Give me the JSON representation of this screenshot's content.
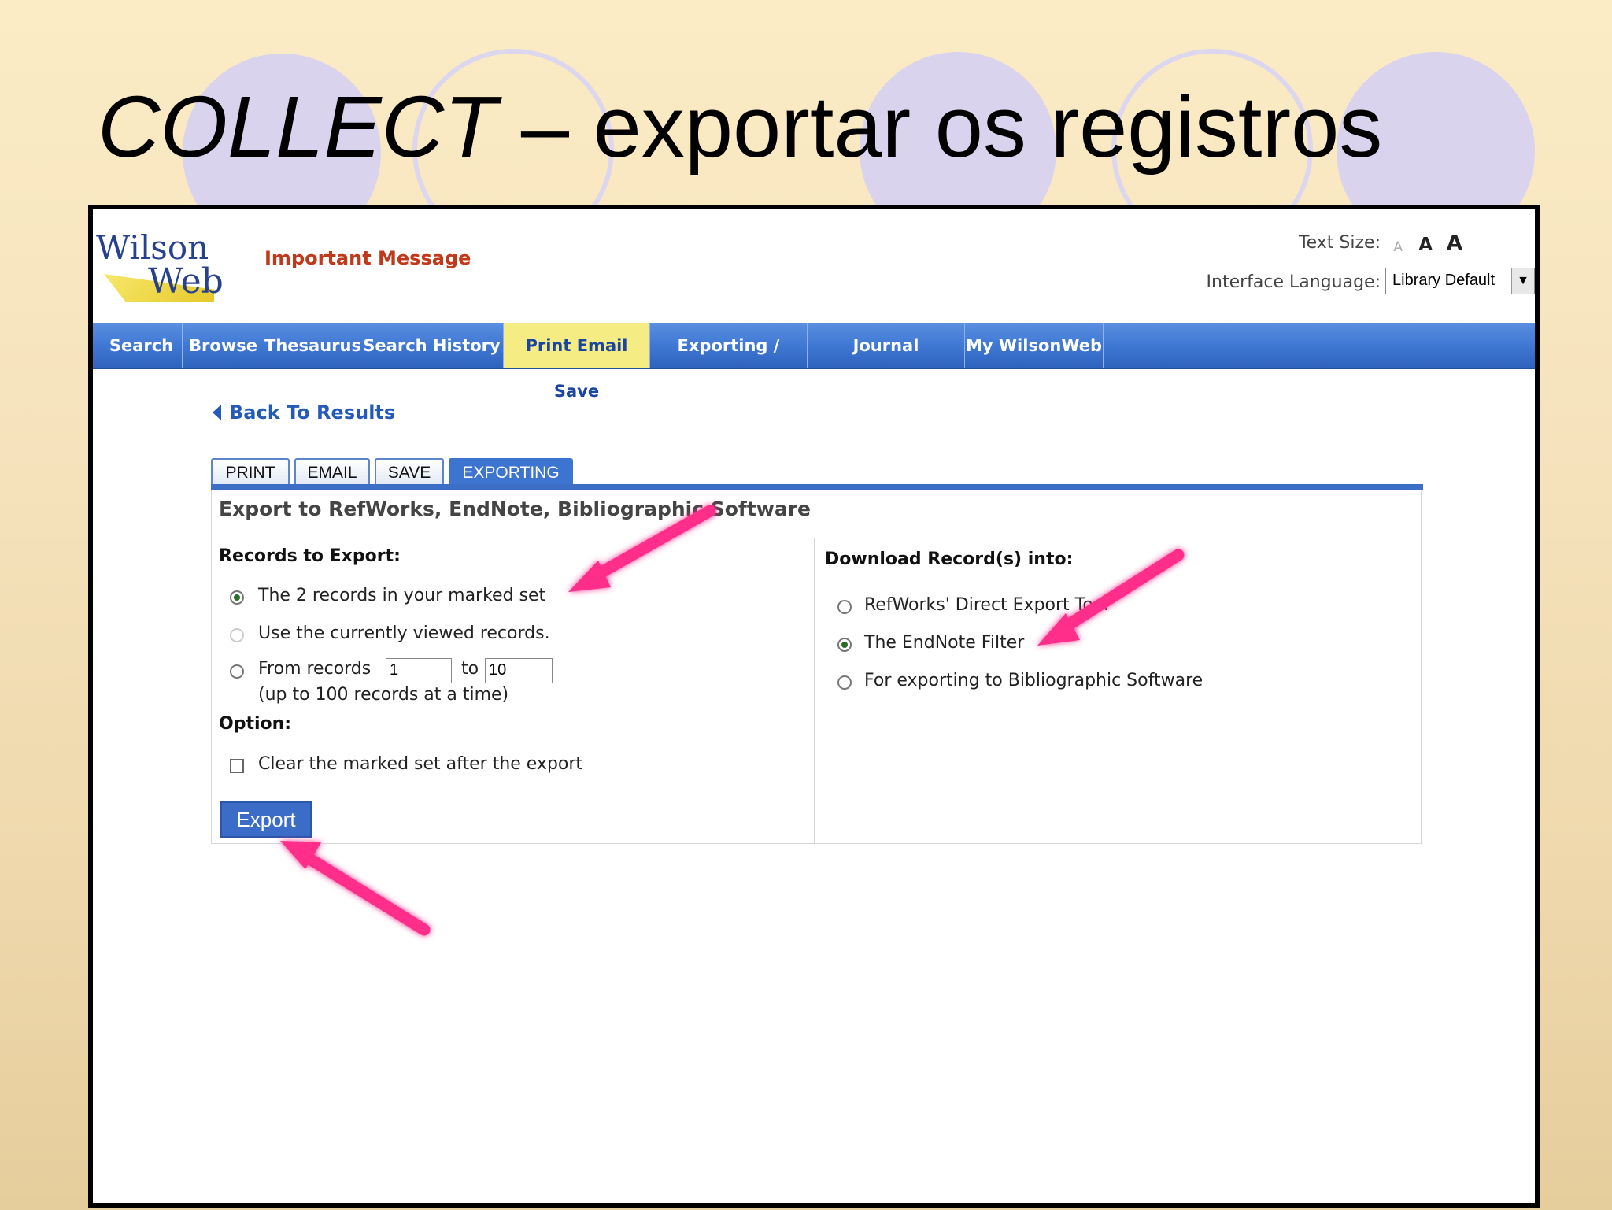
{
  "slide": {
    "title_em": "COLLECT",
    "title_rest": " – exportar os registros"
  },
  "header": {
    "logo_line1": "Wilson",
    "logo_line2": "Web",
    "important_message": "Important Message",
    "text_size_label": "Text Size:",
    "text_size_options": [
      "A",
      "A",
      "A"
    ],
    "interface_language_label": "Interface Language:",
    "interface_language_value": "Library Default"
  },
  "nav": {
    "items": [
      {
        "label": "Search"
      },
      {
        "label": "Browse"
      },
      {
        "label": "Thesaurus"
      },
      {
        "label": "Search History"
      },
      {
        "label": "Print Email Save",
        "active": true
      },
      {
        "label": "Exporting / Citing"
      },
      {
        "label": "Journal Directory"
      },
      {
        "label": "My WilsonWeb"
      }
    ]
  },
  "back_link": "Back To Results",
  "tabs": [
    {
      "label": "PRINT"
    },
    {
      "label": "EMAIL"
    },
    {
      "label": "SAVE"
    },
    {
      "label": "EXPORTING",
      "active": true
    }
  ],
  "panel": {
    "title": "Export to RefWorks, EndNote, Bibliographic Software",
    "records_heading": "Records to Export:",
    "records_options": [
      {
        "label": "The 2 records in your marked set",
        "selected": true
      },
      {
        "label": "Use the currently viewed records.",
        "selected": false
      },
      {
        "label": "From records",
        "selected": false
      }
    ],
    "from_value": "1",
    "to_label": "to",
    "to_value": "10",
    "range_note": "(up to 100 records at a time)",
    "option_heading": "Option:",
    "clear_label": "Clear the marked set after the export",
    "clear_checked": false,
    "export_button": "Export",
    "download_heading": "Download Record(s) into:",
    "download_options": [
      {
        "label": "RefWorks' Direct Export Tool",
        "selected": false
      },
      {
        "label": "The EndNote Filter",
        "selected": true
      },
      {
        "label": "For exporting to Bibliographic Software",
        "selected": false
      }
    ]
  },
  "colors": {
    "nav_blue": "#3f78d4",
    "nav_active": "#f5ed83",
    "important": "#c0391b",
    "link": "#245bb8",
    "annotation_arrow": "#ff2d8a"
  }
}
